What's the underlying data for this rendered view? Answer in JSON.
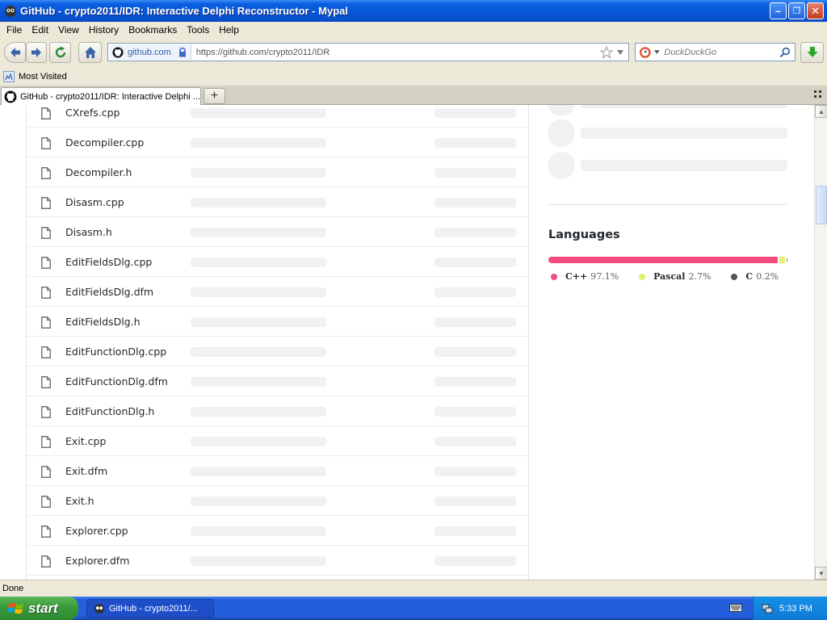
{
  "window": {
    "title": "GitHub - crypto2011/IDR: Interactive Delphi Reconstructor - Mypal",
    "minimize_label": "–",
    "maximize_label": "❐",
    "close_label": "✕"
  },
  "menu": [
    "File",
    "Edit",
    "View",
    "History",
    "Bookmarks",
    "Tools",
    "Help"
  ],
  "nav": {
    "site_identity": "github.com",
    "url": "https://github.com/crypto2011/IDR",
    "search_placeholder": "DuckDuckGo"
  },
  "bookmarks": {
    "most_visited": "Most Visited"
  },
  "tabs": [
    {
      "title": "GitHub - crypto2011/IDR: Interactive Delphi ...",
      "active": true
    }
  ],
  "files": [
    {
      "name": "CXrefs.cpp"
    },
    {
      "name": "Decompiler.cpp"
    },
    {
      "name": "Decompiler.h"
    },
    {
      "name": "Disasm.cpp"
    },
    {
      "name": "Disasm.h"
    },
    {
      "name": "EditFieldsDlg.cpp"
    },
    {
      "name": "EditFieldsDlg.dfm"
    },
    {
      "name": "EditFieldsDlg.h"
    },
    {
      "name": "EditFunctionDlg.cpp"
    },
    {
      "name": "EditFunctionDlg.dfm"
    },
    {
      "name": "EditFunctionDlg.h"
    },
    {
      "name": "Exit.cpp"
    },
    {
      "name": "Exit.dfm"
    },
    {
      "name": "Exit.h"
    },
    {
      "name": "Explorer.cpp"
    },
    {
      "name": "Explorer.dfm"
    },
    {
      "name": ""
    }
  ],
  "languages": {
    "title": "Languages",
    "items": [
      {
        "name": "C++",
        "percent": "97.1%",
        "value": 97.1,
        "color": "#f34b7d"
      },
      {
        "name": "Pascal",
        "percent": "2.7%",
        "value": 2.7,
        "color": "#e3f171"
      },
      {
        "name": "C",
        "percent": "0.2%",
        "value": 0.2,
        "color": "#555555"
      }
    ]
  },
  "status": {
    "text": "Done"
  },
  "taskbar": {
    "start_label": "start",
    "item_label": "GitHub - crypto2011/...",
    "clock": "5:33 PM"
  },
  "colors": {
    "titlebar": "#0755d8",
    "taskbar": "#245edb",
    "start": "#3a9a3c"
  }
}
